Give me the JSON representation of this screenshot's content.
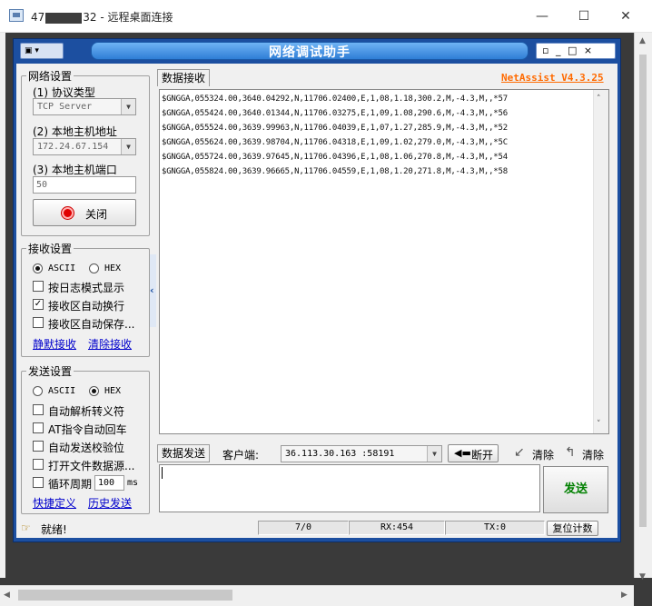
{
  "rdp": {
    "title_prefix": "47",
    "title_suffix": "32 - 远程桌面连接",
    "min": "—",
    "max": "☐",
    "close": "✕"
  },
  "app": {
    "sysmenu": "",
    "title": "网络调试助手",
    "controls": "▫ _ □ ×",
    "brand": "NetAssist V4.3.25"
  },
  "net": {
    "group": "网络设置",
    "proto_label": "(1) 协议类型",
    "proto_value": "TCP Server",
    "ip_label": "(2) 本地主机地址",
    "ip_value": "172.24.67.154",
    "port_label": "(3) 本地主机端口",
    "port_value": "50",
    "close_btn": "关闭"
  },
  "recv_settings": {
    "group": "接收设置",
    "ascii": "ASCII",
    "hex": "HEX",
    "log_mode": "按日志模式显示",
    "auto_wrap": "接收区自动换行",
    "auto_save": "接收区自动保存...",
    "silent": "静默接收",
    "clear": "清除接收"
  },
  "send_settings": {
    "group": "发送设置",
    "ascii": "ASCII",
    "hex": "HEX",
    "escape": "自动解析转义符",
    "at_cr": "AT指令自动回车",
    "checksum": "自动发送校验位",
    "file_src": "打开文件数据源...",
    "cycle": "循环周期",
    "cycle_value": "100",
    "cycle_unit": "ms",
    "shortcut": "快捷定义",
    "history": "历史发送"
  },
  "recv": {
    "tab": "数据接收",
    "lines": [
      "$GNGGA,055324.00,3640.04292,N,11706.02400,E,1,08,1.18,300.2,M,-4.3,M,,*57",
      "$GNGGA,055424.00,3640.01344,N,11706.03275,E,1,09,1.08,290.6,M,-4.3,M,,*56",
      "$GNGGA,055524.00,3639.99963,N,11706.04039,E,1,07,1.27,285.9,M,-4.3,M,,*52",
      "$GNGGA,055624.00,3639.98704,N,11706.04318,E,1,09,1.02,279.0,M,-4.3,M,,*5C",
      "$GNGGA,055724.00,3639.97645,N,11706.04396,E,1,08,1.06,270.8,M,-4.3,M,,*54",
      "$GNGGA,055824.00,3639.96665,N,11706.04559,E,1,08,1.20,271.8,M,-4.3,M,,*58"
    ]
  },
  "send": {
    "tab": "数据发送",
    "client_label": "客户端:",
    "client_value": "36.113.30.163 :58191",
    "disconnect": "断开",
    "clear1": "清除",
    "clear2": "清除",
    "send_btn": "发送"
  },
  "status": {
    "ready": "就绪!",
    "count": "7/0",
    "rx": "RX:454",
    "tx": "TX:0",
    "reset": "复位计数"
  }
}
